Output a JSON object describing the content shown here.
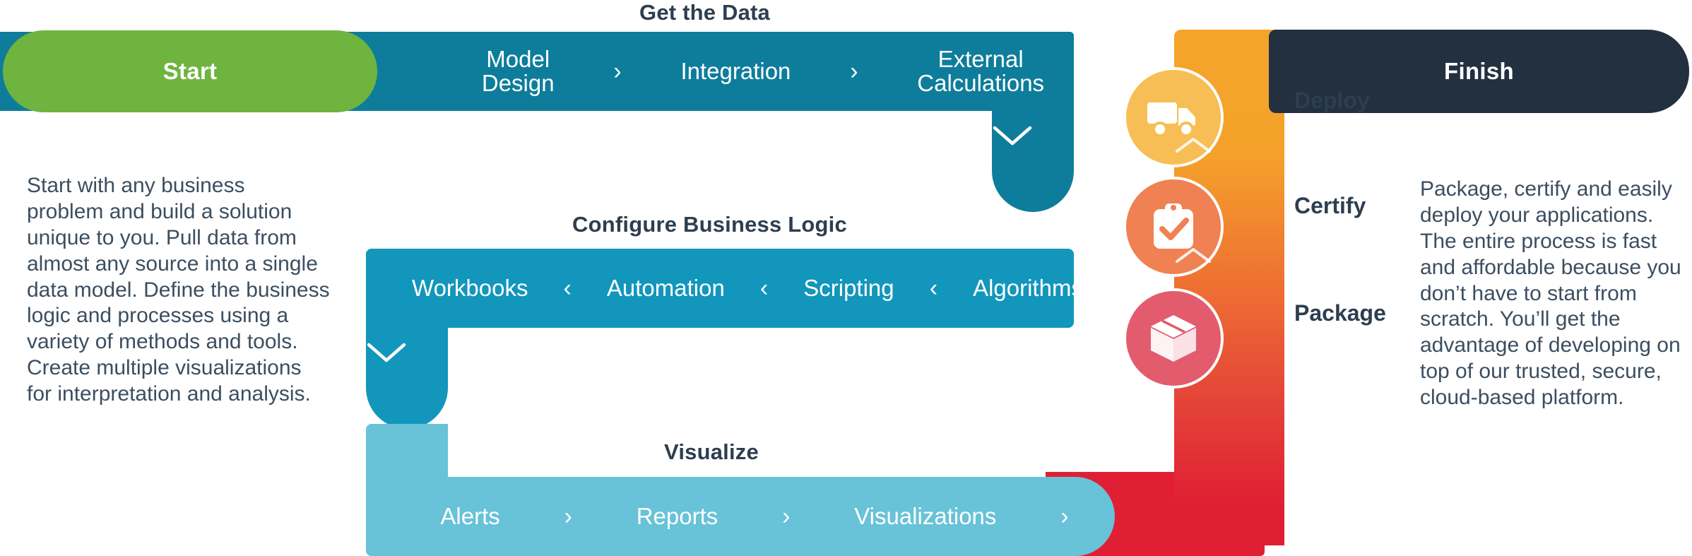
{
  "flow": {
    "start": {
      "label": "Start",
      "color": "#6EB43F"
    },
    "finish": {
      "label": "Finish",
      "color": "#22303F"
    },
    "sections": [
      {
        "title": "Get the Data",
        "color": "#0E7D9B",
        "direction": "right",
        "steps": [
          "Model\nDesign",
          "Integration",
          "External\nCalculations"
        ],
        "separator": "›",
        "elbow_icon": "chevron-down"
      },
      {
        "title": "Configure Business Logic",
        "color": "#1296BC",
        "direction": "left",
        "steps": [
          "Workbooks",
          "Automation",
          "Scripting",
          "Algorithms"
        ],
        "separator": "‹",
        "elbow_icon": "chevron-down"
      },
      {
        "title": "Visualize",
        "color": "#68C2D8",
        "direction": "right",
        "steps": [
          "Alerts",
          "Reports",
          "Visualizations"
        ],
        "separator": "›",
        "elbow_icon": "chevron-right"
      }
    ],
    "left_paragraph": "Start with any business\nproblem and build a solution\nunique to you. Pull data from\nalmost any source into a single\ndata model. Define the business\nlogic and processes using a\nvariety of methods and tools.\nCreate multiple visualizations\nfor interpretation and analysis.",
    "right_paragraph": "Package, certify and easily\ndeploy your applications.\nThe entire process is fast\nand affordable because you\ndon’t have to start from\nscratch. You’ll get the\nadvantage of developing on\ntop of our trusted, secure,\ncloud-based platform."
  },
  "deploy_track": {
    "gradient_top": "#F4A22A",
    "gradient_bottom": "#E01F34",
    "steps": [
      {
        "label": "Deploy",
        "icon": "truck-icon",
        "circle_color": "#F7BE55"
      },
      {
        "label": "Certify",
        "icon": "clipboard-check-icon",
        "circle_color": "#EF8152"
      },
      {
        "label": "Package",
        "icon": "box-icon",
        "circle_color": "#E35C6E"
      }
    ],
    "connector_icon": "chevron-up",
    "red_block_color": "#E01F34"
  }
}
